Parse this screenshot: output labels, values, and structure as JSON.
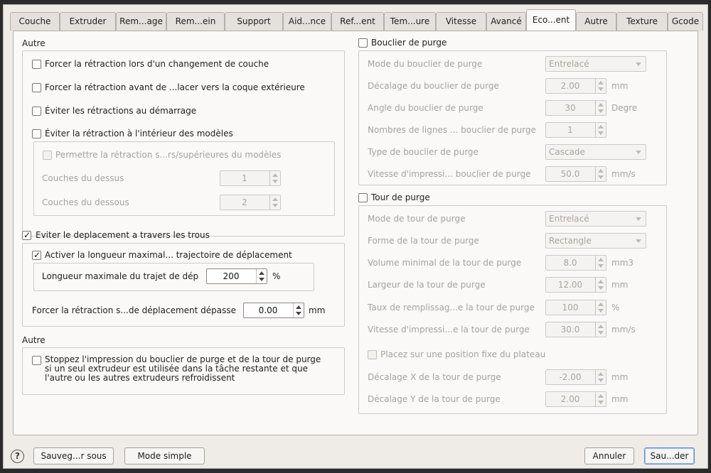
{
  "tabs": [
    {
      "label": "Couche",
      "active": false
    },
    {
      "label": "Extruder",
      "active": false
    },
    {
      "label": "Rem...age",
      "active": false
    },
    {
      "label": "Rem...ein",
      "active": false
    },
    {
      "label": "Support",
      "active": false
    },
    {
      "label": "Aid...nce",
      "active": false
    },
    {
      "label": "Ref...ent",
      "active": false
    },
    {
      "label": "Tem...ure",
      "active": false
    },
    {
      "label": "Vitesse",
      "active": false
    },
    {
      "label": "Avancé",
      "active": false
    },
    {
      "label": "Eco...ent",
      "active": true
    },
    {
      "label": "Autre",
      "active": false
    },
    {
      "label": "Texture",
      "active": false
    },
    {
      "label": "Gcode",
      "active": false
    }
  ],
  "left": {
    "autre1_title": "Autre",
    "force_layer_retract": {
      "label": "Forcer la rétraction lors d'un changement de couche",
      "checked": false
    },
    "force_outer_retract": {
      "label": "Forcer la rétraction avant de ...lacer vers la coque extérieure",
      "checked": false
    },
    "avoid_start_retract": {
      "label": "Éviter les rétractions au démarrage",
      "checked": false
    },
    "avoid_inside_retract": {
      "label": "Éviter la rétraction à l'intérieur des modèles",
      "checked": false
    },
    "allow_top_bottom": {
      "label": "Permettre la rétraction s...rs/supérieures du modèles",
      "checked": false
    },
    "top_layers": {
      "label": "Couches du dessus",
      "value": "1"
    },
    "bottom_layers": {
      "label": "Couches du dessous",
      "value": "2"
    },
    "avoid_holes": {
      "label": "Eviter le deplacement a travers les trous",
      "checked": true
    },
    "max_travel_enable": {
      "label": "Activer la longueur maximal... trajectoire de déplacement",
      "checked": true
    },
    "max_travel_length": {
      "label": "Longueur maximale du trajet de dép",
      "value": "200",
      "unit": "%"
    },
    "force_retract_travel": {
      "label": "Forcer la rétraction s...de déplacement dépasse",
      "value": "0.00",
      "unit": "mm"
    },
    "autre2_title": "Autre",
    "stop_shield": {
      "label": "Stoppez l'impression du bouclier de purge et de la tour de purge si un seul extrudeur est utilisée dans la tâche restante et que l'autre ou les autres extrudeurs refroidissent",
      "checked": false
    }
  },
  "right": {
    "shield": {
      "label": "Bouclier de purge",
      "checked": false,
      "mode": {
        "label": "Mode du bouclier de purge",
        "value": "Entrelacé"
      },
      "offset": {
        "label": "Décalage du bouclier de purge",
        "value": "2.00",
        "unit": "mm"
      },
      "angle": {
        "label": "Angle du bouclier de purge",
        "value": "30",
        "unit": "Degre"
      },
      "lines": {
        "label": "Nombres de lignes ... bouclier de purge",
        "value": "1"
      },
      "type": {
        "label": "Type de bouclier de purge",
        "value": "Cascade"
      },
      "speed": {
        "label": "Vitesse d'impressi... bouclier de purge",
        "value": "50.0",
        "unit": "mm/s"
      }
    },
    "tower": {
      "label": "Tour de purge",
      "checked": false,
      "mode": {
        "label": "Mode de tour de purge",
        "value": "Entrelacé"
      },
      "shape": {
        "label": "Forme de la tour de purge",
        "value": "Rectangle"
      },
      "min_volume": {
        "label": "Volume minimal de la tour de purge",
        "value": "8.0",
        "unit": "mm3"
      },
      "width": {
        "label": "Largeur de la tour de purge",
        "value": "12.00",
        "unit": "mm"
      },
      "infill": {
        "label": "Taux de remplissag...e la tour de purge",
        "value": "100",
        "unit": "%"
      },
      "speed": {
        "label": "Vitesse d'impressi...e la tour de purge",
        "value": "30.0",
        "unit": "mm/s"
      },
      "fixed_pos": {
        "label": "Placez sur une position fixe du plateau",
        "checked": false
      },
      "x_offset": {
        "label": "Décalage X de la tour de purge",
        "value": "-2.00",
        "unit": "mm"
      },
      "y_offset": {
        "label": "Décalage Y de la tour de purge",
        "value": "2.00",
        "unit": "mm"
      }
    }
  },
  "footer": {
    "help_glyph": "?",
    "save_as": "Sauveg...r sous",
    "simple_mode": "Mode simple",
    "cancel": "Annuler",
    "save": "Sau...der"
  }
}
